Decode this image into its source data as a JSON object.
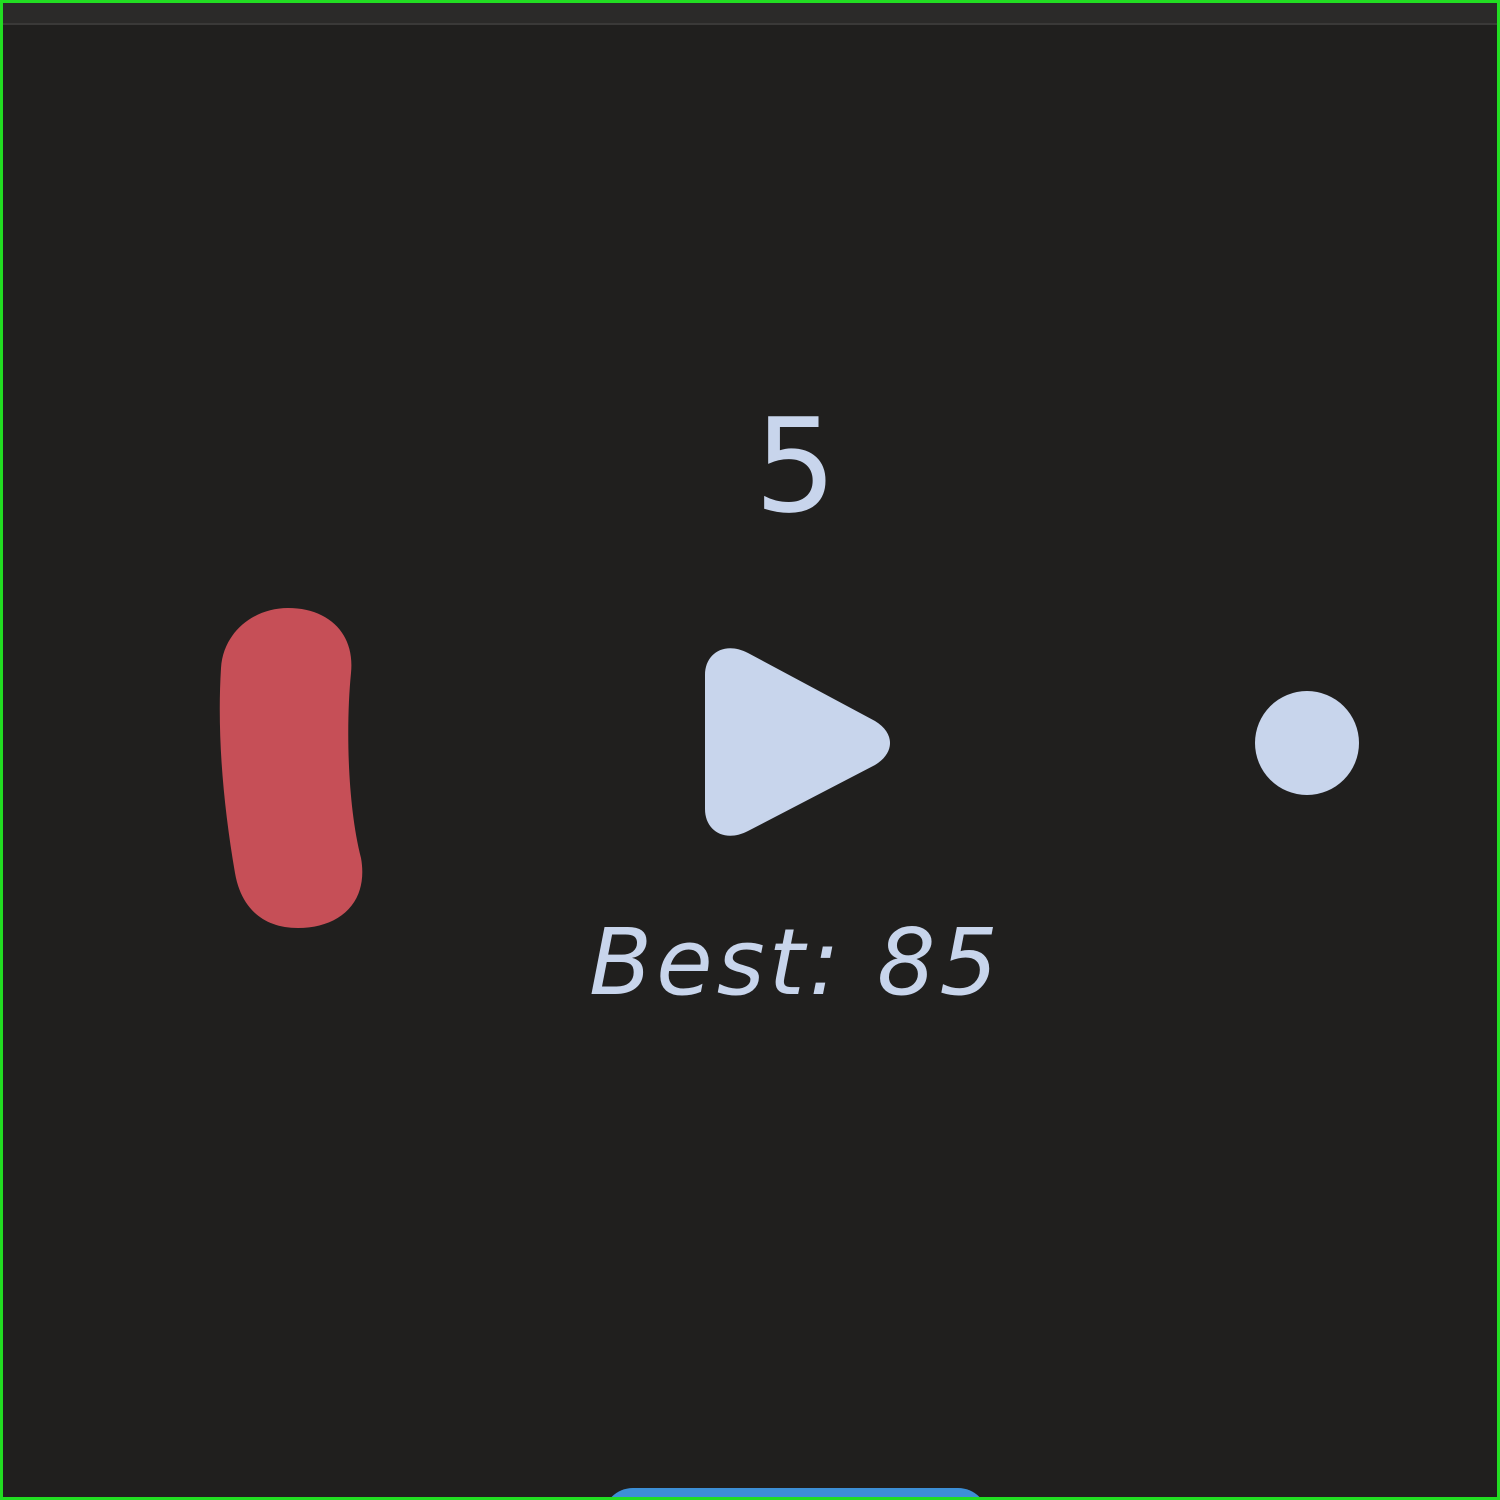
{
  "game": {
    "score": "5",
    "best_label": "Best: 85",
    "play_icon": "play-icon",
    "colors": {
      "background": "#201f1e",
      "foreground": "#c8d5ec",
      "paddle": "#c64f57",
      "button": "#3d8fd6"
    }
  }
}
